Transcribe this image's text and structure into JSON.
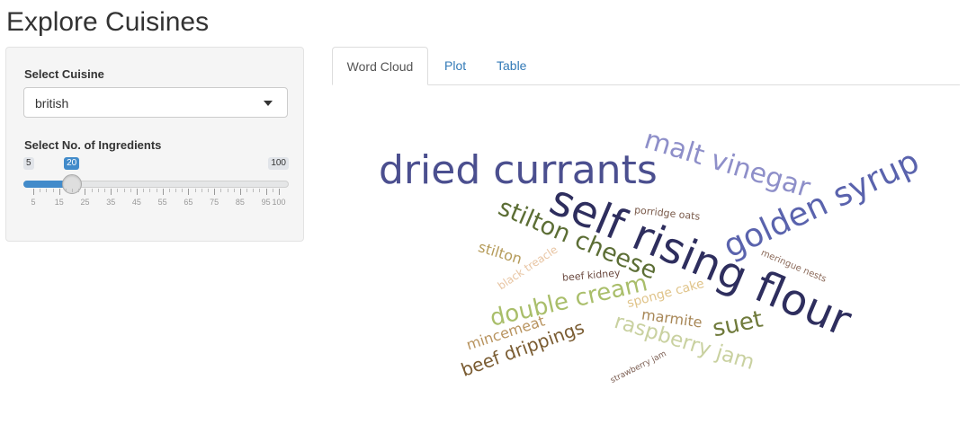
{
  "app": {
    "title": "Explore Cuisines"
  },
  "sidebar": {
    "cuisine_label": "Select Cuisine",
    "cuisine_value": "british",
    "ingredients_label": "Select No. of Ingredients",
    "slider": {
      "min_label": "5",
      "max_label": "100",
      "value_label": "20",
      "value": 20,
      "min": 5,
      "max": 100,
      "tick_labels": [
        "5",
        "15",
        "25",
        "35",
        "45",
        "55",
        "65",
        "75",
        "85",
        "95",
        "100"
      ]
    }
  },
  "tabs": [
    {
      "label": "Word Cloud",
      "active": true
    },
    {
      "label": "Plot",
      "active": false
    },
    {
      "label": "Table",
      "active": false
    }
  ],
  "wordcloud": {
    "words": [
      {
        "text": "self rising flour",
        "color": "#2e2e5e"
      },
      {
        "text": "dried currants",
        "color": "#4b4f8f"
      },
      {
        "text": "golden syrup",
        "color": "#5a63ad"
      },
      {
        "text": "malt vinegar",
        "color": "#8e8fc9"
      },
      {
        "text": "stilton cheese",
        "color": "#5c6e35"
      },
      {
        "text": "double cream",
        "color": "#a9be6a"
      },
      {
        "text": "raspberry jam",
        "color": "#c9d1a0"
      },
      {
        "text": "suet",
        "color": "#6f7a3b"
      },
      {
        "text": "beef drippings",
        "color": "#7a5c32"
      },
      {
        "text": "mincemeat",
        "color": "#b8935e"
      },
      {
        "text": "marmite",
        "color": "#a88757"
      },
      {
        "text": "sponge cake",
        "color": "#e0c48a"
      },
      {
        "text": "stilton",
        "color": "#b59b59"
      },
      {
        "text": "black treacle",
        "color": "#e8c5a3"
      },
      {
        "text": "porridge oats",
        "color": "#7a5a4a"
      },
      {
        "text": "beef kidney",
        "color": "#6b4a40"
      },
      {
        "text": "meringue nests",
        "color": "#8b6a5a"
      },
      {
        "text": "strawberry jam",
        "color": "#7a5c50"
      }
    ]
  }
}
